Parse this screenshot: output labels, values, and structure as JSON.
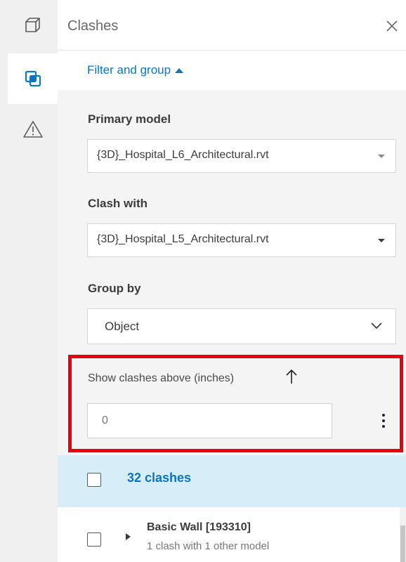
{
  "rail": {
    "items": [
      {
        "name": "model-icon"
      },
      {
        "name": "clashes-icon",
        "active": true
      },
      {
        "name": "warning-icon"
      }
    ]
  },
  "header": {
    "title": "Clashes",
    "close_icon": "close-icon"
  },
  "filter": {
    "toggle_label": "Filter and group",
    "expanded": true
  },
  "primary_model": {
    "label": "Primary model",
    "value": "{3D}_Hospital_L6_Architectural.rvt"
  },
  "clash_with": {
    "label": "Clash with",
    "value": "{3D}_Hospital_L5_Architectural.rvt"
  },
  "group_by": {
    "label": "Group by",
    "value": "Object"
  },
  "threshold": {
    "label": "Show clashes above (inches)",
    "placeholder": "0",
    "arrow_icon": "arrow-up-icon",
    "menu_icon": "more-vertical-icon"
  },
  "results": {
    "count_label": "32 clashes"
  },
  "list": {
    "items": [
      {
        "title": "Basic Wall [193310]",
        "subtitle": "1 clash with 1 other model"
      }
    ]
  },
  "colors": {
    "accent": "#0a75c0",
    "highlight_box": "#e8000b",
    "results_bg": "#d7edf8",
    "panel_bg": "#f4f4f4"
  }
}
